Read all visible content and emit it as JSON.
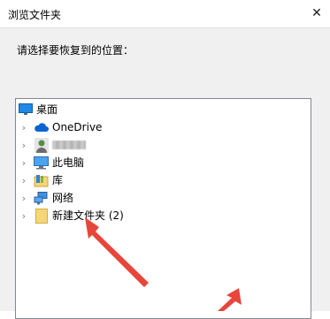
{
  "window": {
    "title": "浏览文件夹",
    "close_glyph": "✕"
  },
  "prompt": "请选择要恢复到的位置：",
  "tree": {
    "items": [
      {
        "label": "桌面",
        "icon": "desktop-icon",
        "expandable": false
      },
      {
        "label": "OneDrive",
        "icon": "onedrive-cloud-icon",
        "expandable": true
      },
      {
        "label": "",
        "icon": "user-avatar-icon",
        "expandable": true,
        "blurred": true
      },
      {
        "label": "此电脑",
        "icon": "computer-icon",
        "expandable": true
      },
      {
        "label": "库",
        "icon": "library-icon",
        "expandable": true
      },
      {
        "label": "网络",
        "icon": "network-icon",
        "expandable": true
      },
      {
        "label": "新建文件夹 (2)",
        "icon": "folder-icon",
        "expandable": true
      }
    ]
  },
  "colors": {
    "annotation_arrow": "#e8463a",
    "onedrive_blue": "#0a64d0",
    "folder_yellow": "#f5d77a"
  }
}
